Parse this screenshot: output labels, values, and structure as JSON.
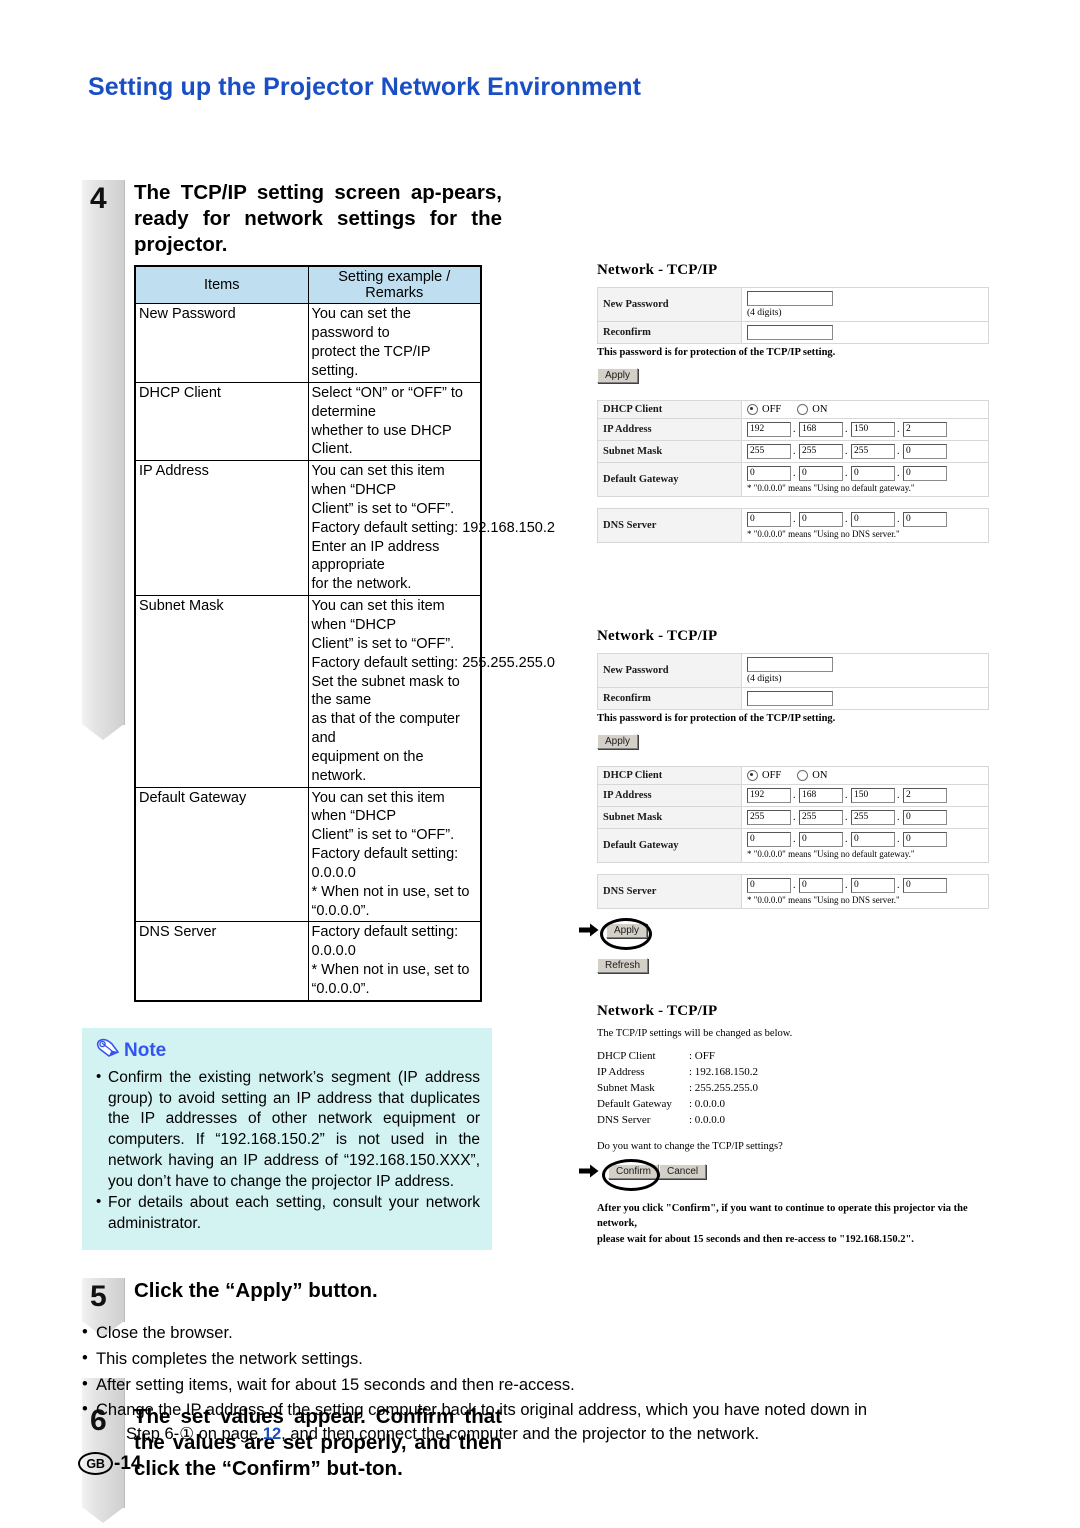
{
  "page": {
    "title": "Setting up the Projector Network Environment",
    "footer_locale": "GB",
    "footer_page": "-14"
  },
  "steps": [
    {
      "number": "4",
      "heading": "The TCP/IP setting screen ap-pears, ready for network settings for the projector."
    },
    {
      "number": "5",
      "heading": "Click the “Apply” button."
    },
    {
      "number": "6",
      "heading": "The set values appear. Confirm that the values are set properly, and then click the “Confirm” but-ton."
    }
  ],
  "spec_table": {
    "headers": [
      "Items",
      "Setting example / Remarks"
    ],
    "rows": [
      {
        "item": "New Password",
        "remarks": [
          "You can set the password to",
          "protect the TCP/IP setting."
        ]
      },
      {
        "item": "DHCP Client",
        "remarks": [
          "Select “ON” or “OFF” to determine",
          "whether to use DHCP Client."
        ]
      },
      {
        "item": "IP Address",
        "remarks": [
          "You can set this item when “DHCP",
          "Client” is set to “OFF”.",
          "Factory default setting: 192.168.150.2",
          "Enter an IP address appropriate",
          "for the network."
        ]
      },
      {
        "item": "Subnet Mask",
        "remarks": [
          "You can set this item when “DHCP",
          "Client” is set to “OFF”.",
          "Factory default setting: 255.255.255.0",
          "Set the subnet mask to the same",
          "as that of the computer and",
          "equipment on the network."
        ]
      },
      {
        "item": "Default Gateway",
        "remarks": [
          "You can set this item when “DHCP",
          "Client” is set to “OFF”.",
          "Factory default setting: 0.0.0.0",
          "* When not in use, set to “0.0.0.0”."
        ]
      },
      {
        "item": "DNS Server",
        "remarks": [
          "Factory default setting: 0.0.0.0",
          "* When not in use, set to “0.0.0.0”."
        ]
      }
    ]
  },
  "note": {
    "icon": "pencil-icon",
    "label": "Note",
    "color": "#3355ee",
    "background": "#d3f2f2",
    "items": [
      "Confirm the existing network’s segment (IP address group) to avoid setting an IP address that duplicates the IP addresses of other network equipment or computers. If “192.168.150.2” is not used in the network having an IP address of “192.168.150.XXX”, you don’t have to change the projector IP address.",
      "For details about each setting, consult your network administrator."
    ]
  },
  "bottom_bullets": {
    "items": [
      "Close the browser.",
      "This completes the network settings.",
      "After setting items, wait for about 15 seconds and then re-access."
    ],
    "last_item_part1": "Change the IP address of the setting computer back to its original address, which you have noted down in",
    "last_item_part2a": "Step 6-① on page",
    "last_item_page": "12",
    "last_item_part2b": ", and then connect the computer and the projector to the network."
  },
  "screens": {
    "password_form": {
      "title": "Network - TCP/IP",
      "rows": [
        {
          "label": "New Password",
          "value": "",
          "hint": "(4 digits)"
        },
        {
          "label": "Reconfirm",
          "value": "",
          "hint": ""
        }
      ],
      "note": "This password is for protection of the TCP/IP setting.",
      "apply_label": "Apply"
    },
    "tcpip_form": {
      "dhcp_label": "DHCP Client",
      "dhcp_off": "OFF",
      "dhcp_on": "ON",
      "dhcp_selected": "OFF",
      "ip_label": "IP Address",
      "ip_octets": [
        "192",
        "168",
        "150",
        "2"
      ],
      "subnet_label": "Subnet Mask",
      "subnet_octets": [
        "255",
        "255",
        "255",
        "0"
      ],
      "gateway_label": "Default Gateway",
      "gateway_octets": [
        "0",
        "0",
        "0",
        "0"
      ],
      "gateway_hint": "* \"0.0.0.0\" means \"Using no default gateway.\"",
      "dns_label": "DNS Server",
      "dns_octets": [
        "0",
        "0",
        "0",
        "0"
      ],
      "dns_hint": "* \"0.0.0.0\" means \"Using no DNS server.\"",
      "apply_label": "Apply",
      "refresh_label": "Refresh"
    },
    "confirm_screen": {
      "title": "Network - TCP/IP",
      "lead": "The TCP/IP settings will be changed as below.",
      "values": [
        {
          "key": "DHCP Client",
          "value": ": OFF"
        },
        {
          "key": "IP Address",
          "value": ": 192.168.150.2"
        },
        {
          "key": "Subnet Mask",
          "value": ": 255.255.255.0"
        },
        {
          "key": "Default Gateway",
          "value": ": 0.0.0.0"
        },
        {
          "key": "DNS Server",
          "value": ": 0.0.0.0"
        }
      ],
      "question": "Do you want to change the TCP/IP settings?",
      "confirm_label": "Confirm",
      "cancel_label": "Cancel",
      "tail_line1": "After you click \"Confirm\", if you want to continue to operate this projector via the network,",
      "tail_line2": "please wait for about 15 seconds and then re-access to \"192.168.150.2\"."
    }
  }
}
